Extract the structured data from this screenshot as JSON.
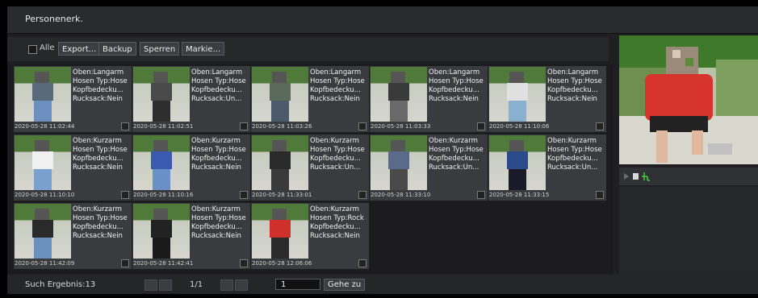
{
  "window": {
    "title": "Personenerk."
  },
  "toolbar": {
    "select_all_label": "Alle",
    "export_label": "Export...",
    "backup_label": "Backup",
    "lock_label": "Sperren",
    "mark_label": "Markie..."
  },
  "results": [
    {
      "upper": "Oben:Langarm",
      "pants": "Hosen Typ:Hose",
      "headwear": "Kopfbedecku...",
      "backpack": "Rucksack:Nein",
      "time": "2020-05-28 11:02:44",
      "shirt_color": "#5b6a7a",
      "pants_color": "#6a8fc0"
    },
    {
      "upper": "Oben:Langarm",
      "pants": "Hosen Typ:Hose",
      "headwear": "Kopfbedecku...",
      "backpack": "Rucksack:Un...",
      "time": "2020-05-28 11:02:51",
      "shirt_color": "#4a4a4a",
      "pants_color": "#2e2e2e"
    },
    {
      "upper": "Oben:Langarm",
      "pants": "Hosen Typ:Hose",
      "headwear": "Kopfbedecku...",
      "backpack": "Rucksack:Nein",
      "time": "2020-05-28 11:03:26",
      "shirt_color": "#5a6a5a",
      "pants_color": "#4a5a6a"
    },
    {
      "upper": "Oben:Langarm",
      "pants": "Hosen Typ:Hose",
      "headwear": "Kopfbedecku...",
      "backpack": "Rucksack:Nein",
      "time": "2020-05-28 11:03:33",
      "shirt_color": "#3a3a3a",
      "pants_color": "#6a6a6a"
    },
    {
      "upper": "Oben:Langarm",
      "pants": "Hosen Typ:Hose",
      "headwear": "Kopfbedecku...",
      "backpack": "Rucksack:Nein",
      "time": "2020-05-28 11:10:06",
      "shirt_color": "#e0e0e0",
      "pants_color": "#8ab0d0"
    },
    {
      "upper": "Oben:Kurzarm",
      "pants": "Hosen Typ:Hose",
      "headwear": "Kopfbedecku...",
      "backpack": "Rucksack:Nein",
      "time": "2020-05-28 11:10:10",
      "shirt_color": "#f0f0f0",
      "pants_color": "#7aa0d0"
    },
    {
      "upper": "Oben:Kurzarm",
      "pants": "Hosen Typ:Hose",
      "headwear": "Kopfbedecku...",
      "backpack": "Rucksack:Nein",
      "time": "2020-05-28 11:10:16",
      "shirt_color": "#3a5ab0",
      "pants_color": "#6a90c8"
    },
    {
      "upper": "Oben:Kurzarm",
      "pants": "Hosen Typ:Hose",
      "headwear": "Kopfbedecku...",
      "backpack": "Rucksack:Un...",
      "time": "2020-05-28 11:33:01",
      "shirt_color": "#2a2a2a",
      "pants_color": "#3a3a3a"
    },
    {
      "upper": "Oben:Kurzarm",
      "pants": "Hosen Typ:Hose",
      "headwear": "Kopfbedecku...",
      "backpack": "Rucksack:Un...",
      "time": "2020-05-28 11:33:10",
      "shirt_color": "#5a6a8a",
      "pants_color": "#4a4a4a"
    },
    {
      "upper": "Oben:Kurzarm",
      "pants": "Hosen Typ:Hose",
      "headwear": "Kopfbedecku...",
      "backpack": "Rucksack:Un...",
      "time": "2020-05-28 11:33:15",
      "shirt_color": "#2a4a8a",
      "pants_color": "#1a1a2a"
    },
    {
      "upper": "Oben:Kurzarm",
      "pants": "Hosen Typ:Hose",
      "headwear": "Kopfbedecku...",
      "backpack": "Rucksack:Nein",
      "time": "2020-05-28 11:42:09",
      "shirt_color": "#2a2a2a",
      "pants_color": "#6a90c0"
    },
    {
      "upper": "Oben:Kurzarm",
      "pants": "Hosen Typ:Hose",
      "headwear": "Kopfbedecku...",
      "backpack": "Rucksack:Nein",
      "time": "2020-05-28 11:42:41",
      "shirt_color": "#222222",
      "pants_color": "#1a1a1a"
    },
    {
      "upper": "Oben:Kurzarm",
      "pants": "Hosen Typ:Rock",
      "headwear": "Kopfbedecku...",
      "backpack": "Rucksack:Nein",
      "time": "2020-05-28 12:06:06",
      "shirt_color": "#d0302a",
      "pants_color": "#2a2a2a"
    }
  ],
  "preview": {
    "shirt_color": "#d8342e",
    "pants_color": "#222222"
  },
  "footer": {
    "result_label": "Such Ergebnis:13",
    "pagination": "1/1",
    "page_input": "1",
    "goto_label": "Gehe zu"
  },
  "colors": {
    "accent_green": "#3cd13c"
  }
}
